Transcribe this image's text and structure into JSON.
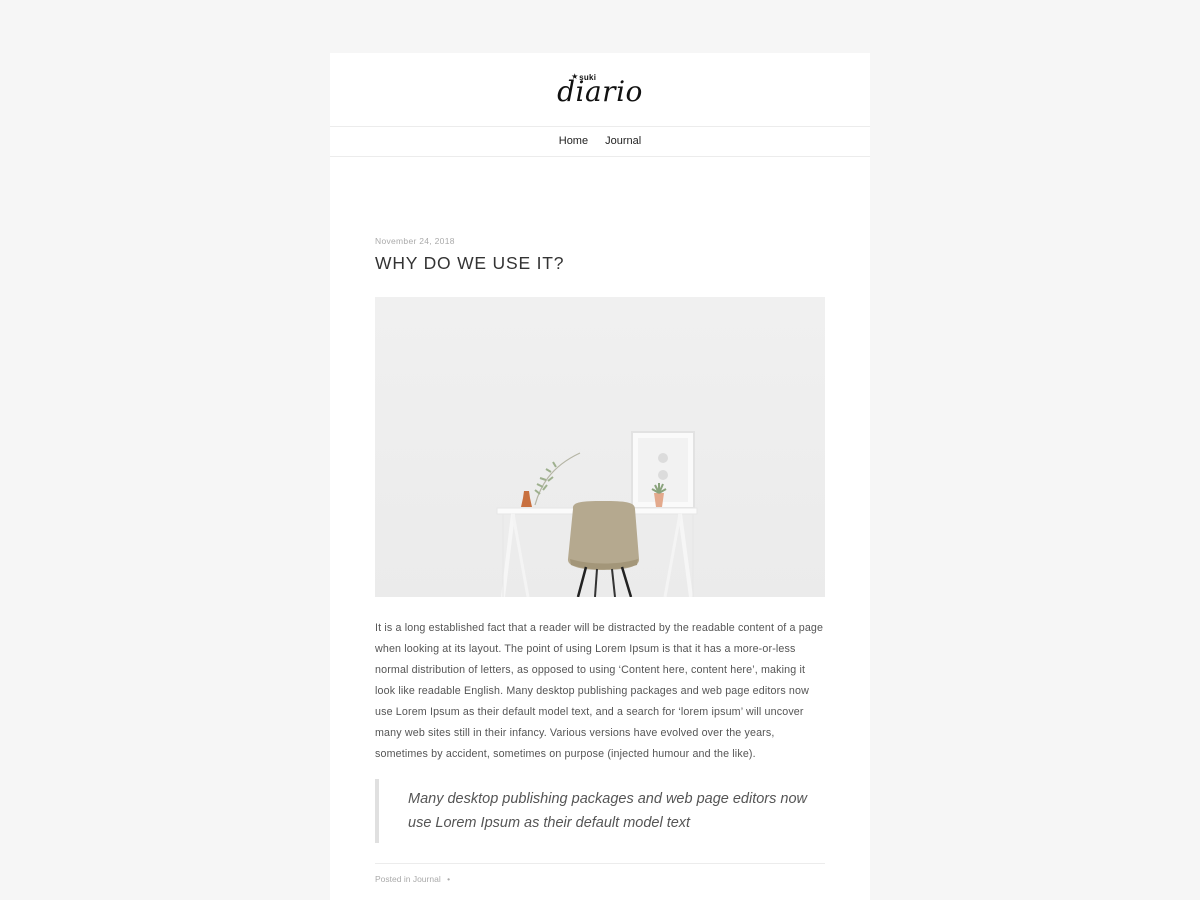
{
  "site": {
    "logo_main": "diario",
    "logo_small": "suki",
    "logo_mark": "★"
  },
  "nav": {
    "items": [
      {
        "label": "Home"
      },
      {
        "label": "Journal"
      }
    ]
  },
  "post": {
    "date": "November 24, 2018",
    "title": "WHY DO WE USE IT?",
    "image_alt_icon": "desk-chair-photo",
    "body": "It is a long established fact that a reader will be distracted by the readable content of a page when looking at its layout. The point of using Lorem Ipsum is that it has a more-or-less normal distribution of letters, as opposed to using ‘Content here, content here’, making it look like readable English. Many desktop publishing packages and web page editors now use Lorem Ipsum as their default model text, and a search for ‘lorem ipsum’ will uncover many web sites still in their infancy. Various versions have evolved over the years, sometimes by accident, sometimes on purpose (injected humour and the like).",
    "quote": "Many desktop publishing packages and web page editors now use Lorem Ipsum as their default model text",
    "footer_prefix": "Posted in",
    "footer_category": "Journal",
    "footer_sep": "•"
  },
  "colors": {
    "background": "#f6f6f6",
    "card": "#ffffff",
    "quote_border": "#e0e0e0",
    "muted_text": "#aaaaaa"
  }
}
